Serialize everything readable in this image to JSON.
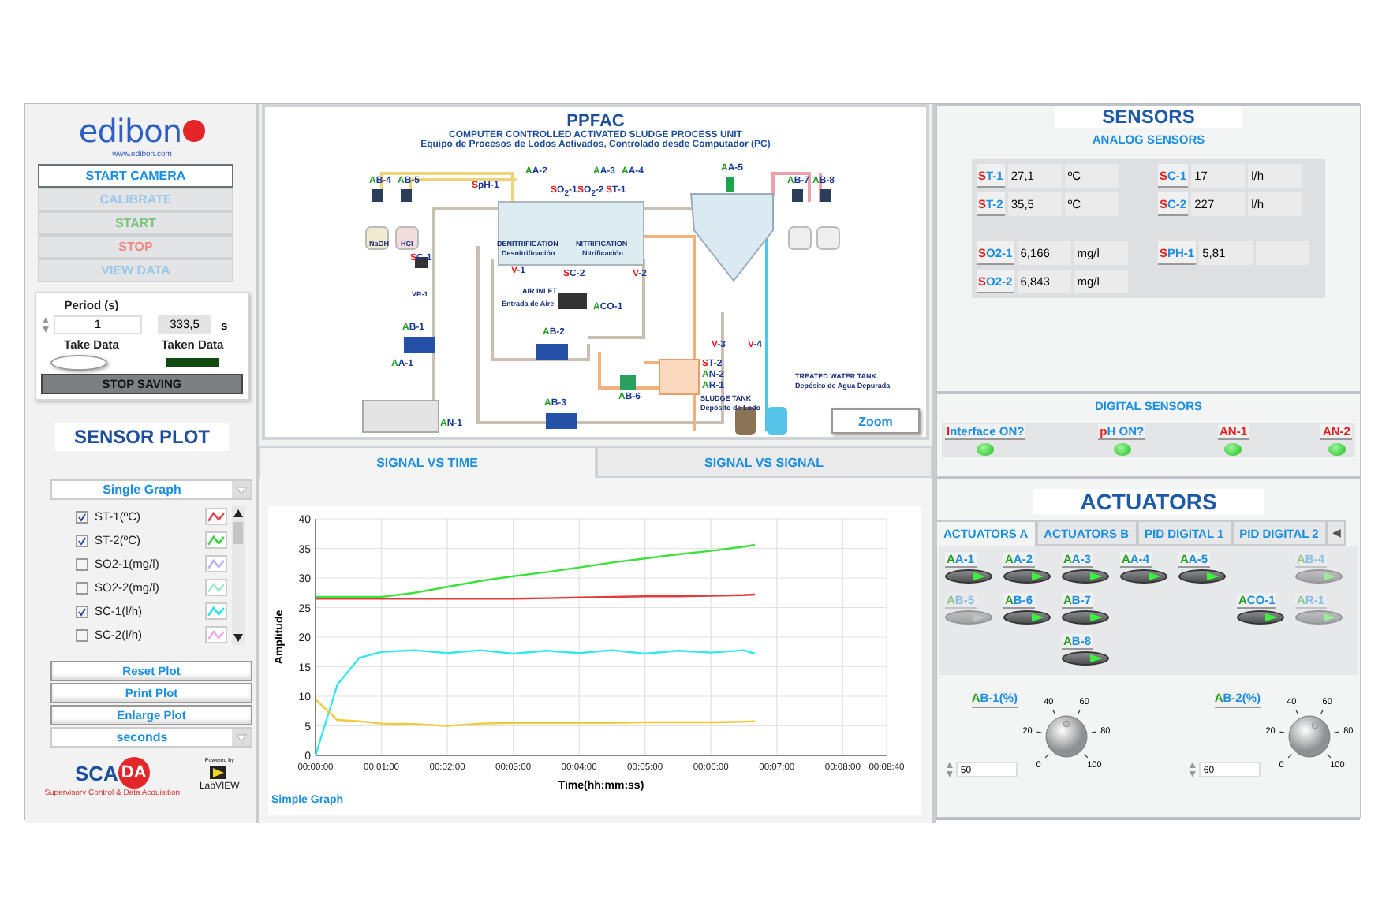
{
  "logo": {
    "brand": "edibon",
    "url": "www.edibon.com"
  },
  "control_buttons": [
    {
      "label": "START CAMERA",
      "color": "#1e8fe0",
      "disabled": false
    },
    {
      "label": "CALIBRATE",
      "color": "#9cc8ea",
      "disabled": true
    },
    {
      "label": "START",
      "color": "#7cc47c",
      "disabled": true
    },
    {
      "label": "STOP",
      "color": "#f08a8a",
      "disabled": true
    },
    {
      "label": "VIEW DATA",
      "color": "#9cc8ea",
      "disabled": true
    }
  ],
  "acquisition": {
    "period_label": "Period (s)",
    "period": "1",
    "elapsed": "333,5",
    "elapsed_unit": "s",
    "take_data": {
      "label": "Take Data",
      "on": false
    },
    "taken_data": {
      "label": "Taken Data",
      "on": false
    },
    "stop_button": "STOP SAVING"
  },
  "sensor_plot": {
    "title": "SENSOR PLOT",
    "mode": "Single Graph",
    "signals": [
      {
        "label": "ST-1(ºC)",
        "checked": true,
        "color": "#e05050"
      },
      {
        "label": "ST-2(ºC)",
        "checked": true,
        "color": "#40d040"
      },
      {
        "label": "SO2-1(mg/l)",
        "checked": false,
        "color": "#b8b8e8"
      },
      {
        "label": "SO2-2(mg/l)",
        "checked": false,
        "color": "#a8e8c8"
      },
      {
        "label": "SC-1(l/h)",
        "checked": true,
        "color": "#30e0e0"
      },
      {
        "label": "SC-2(l/h)",
        "checked": false,
        "color": "#e8b0e8"
      }
    ],
    "buttons": [
      "Reset Plot",
      "Print Plot",
      "Enlarge Plot"
    ],
    "time_unit": "seconds",
    "tabs": [
      {
        "label": "SIGNAL VS TIME",
        "selected": true
      },
      {
        "label": "SIGNAL VS SIGNAL",
        "selected": false
      }
    ],
    "chart_caption": "Simple Graph",
    "chart_data": {
      "type": "line",
      "xlabel": "Time(hh:mm:ss)",
      "ylabel": "Amplitude",
      "x": [
        0,
        20,
        40,
        60,
        90,
        120,
        150,
        180,
        210,
        240,
        270,
        300,
        330,
        360,
        390,
        400
      ],
      "series": [
        {
          "color": "#e03c3c",
          "values": [
            26.5,
            26.5,
            26.5,
            26.5,
            26.5,
            26.5,
            26.5,
            26.5,
            26.6,
            26.7,
            26.8,
            26.9,
            26.9,
            27.0,
            27.1,
            27.2
          ]
        },
        {
          "color": "#3ee03e",
          "values": [
            26.8,
            26.8,
            26.8,
            26.8,
            27.5,
            28.5,
            29.5,
            30.3,
            31.0,
            31.8,
            32.6,
            33.3,
            34.0,
            34.6,
            35.3,
            35.6
          ]
        },
        {
          "color": "#33e6f0",
          "values": [
            0,
            12,
            16.5,
            17.5,
            17.8,
            17.3,
            17.8,
            17.2,
            17.7,
            17.3,
            17.8,
            17.2,
            17.7,
            17.4,
            17.8,
            17.2
          ]
        },
        {
          "color": "#f0c93a",
          "values": [
            9.5,
            6.0,
            5.8,
            5.4,
            5.3,
            5.0,
            5.4,
            5.5,
            5.5,
            5.5,
            5.5,
            5.6,
            5.6,
            5.6,
            5.7,
            5.8
          ]
        }
      ],
      "xlim": [
        0,
        520
      ],
      "ylim": [
        0,
        40
      ],
      "grid": true,
      "xticks": [
        {
          "value": 0,
          "label": "00:00:00"
        },
        {
          "value": 60,
          "label": "00:01:00"
        },
        {
          "value": 120,
          "label": "00:02:00"
        },
        {
          "value": 180,
          "label": "00:03:00"
        },
        {
          "value": 240,
          "label": "00:04:00"
        },
        {
          "value": 300,
          "label": "00:05:00"
        },
        {
          "value": 360,
          "label": "00:06:00"
        },
        {
          "value": 420,
          "label": "00:07:00"
        },
        {
          "value": 480,
          "label": "00:08:00"
        },
        {
          "value": 520,
          "label": "00:08:40"
        }
      ],
      "yticks": [
        0,
        5,
        10,
        15,
        20,
        25,
        30,
        35,
        40
      ]
    }
  },
  "scada_logo": {
    "left": "SCA",
    "right": "DA",
    "tagline": "Supervisory Control & Data Acquisition"
  },
  "labview_logo": {
    "powered_by": "Powered by",
    "name": "LabVIEW"
  },
  "diagram": {
    "title": "PPFAC",
    "subtitle": "COMPUTER CONTROLLED ACTIVATED SLUDGE PROCESS UNIT",
    "subtitle_es": "Equipo de Procesos de Lodos Activados, Controlado desde Computador (PC)",
    "labels": [
      {
        "text": "AB-4",
        "kind": "actuator"
      },
      {
        "text": "AB-5",
        "kind": "actuator"
      },
      {
        "text": "SpH-1",
        "kind": "sensor"
      },
      {
        "text": "AA-2",
        "kind": "actuator"
      },
      {
        "text": "SO$_{2}$-1",
        "kind": "sensor"
      },
      {
        "text": "SO$_{2}$-2",
        "kind": "sensor"
      },
      {
        "text": "ST-1",
        "kind": "sensor"
      },
      {
        "text": "AA-3",
        "kind": "actuator"
      },
      {
        "text": "AA-4",
        "kind": "actuator"
      },
      {
        "text": "AA-5",
        "kind": "actuator"
      },
      {
        "text": "AB-7",
        "kind": "actuator"
      },
      {
        "text": "AB-8",
        "kind": "actuator"
      },
      {
        "text": "NaOH",
        "kind": "caption"
      },
      {
        "text": "HCl",
        "kind": "caption"
      },
      {
        "text": "SC-1",
        "kind": "sensor"
      },
      {
        "text": "DENITRIFICATION",
        "kind": "caption"
      },
      {
        "text": "Desnitrificación",
        "kind": "caption"
      },
      {
        "text": "NITRIFICATION",
        "kind": "caption"
      },
      {
        "text": "Nitrificación",
        "kind": "caption"
      },
      {
        "text": "V-1",
        "kind": "sensor"
      },
      {
        "text": "SC-2",
        "kind": "sensor"
      },
      {
        "text": "V-2",
        "kind": "sensor"
      },
      {
        "text": "AIR INLET",
        "kind": "caption"
      },
      {
        "text": "Entrada de Aire",
        "kind": "caption"
      },
      {
        "text": "ACO-1",
        "kind": "actuator"
      },
      {
        "text": "VR-1",
        "kind": "caption"
      },
      {
        "text": "AB-1",
        "kind": "actuator"
      },
      {
        "text": "AB-2",
        "kind": "actuator"
      },
      {
        "text": "AA-1",
        "kind": "actuator"
      },
      {
        "text": "V-3",
        "kind": "sensor"
      },
      {
        "text": "V-4",
        "kind": "sensor"
      },
      {
        "text": "ST-2",
        "kind": "sensor"
      },
      {
        "text": "AN-2",
        "kind": "actuator"
      },
      {
        "text": "AR-1",
        "kind": "actuator"
      },
      {
        "text": "AB-6",
        "kind": "actuator"
      },
      {
        "text": "AB-3",
        "kind": "actuator"
      },
      {
        "text": "AN-1",
        "kind": "actuator"
      },
      {
        "text": "SLUDGE TANK",
        "kind": "caption"
      },
      {
        "text": "Depósito de Lodo",
        "kind": "caption"
      },
      {
        "text": "TREATED WATER TANK",
        "kind": "caption"
      },
      {
        "text": "Depósito de Agua Depurada",
        "kind": "caption"
      }
    ],
    "zoom_button": "Zoom"
  },
  "sensors": {
    "title": "SENSORS",
    "analog_title": "ANALOG SENSORS",
    "analog": [
      {
        "label": "ST-1",
        "value": "27,1",
        "unit": "ºC"
      },
      {
        "label": "SC-1",
        "value": "17",
        "unit": "l/h"
      },
      {
        "label": "ST-2",
        "value": "35,5",
        "unit": "ºC"
      },
      {
        "label": "SC-2",
        "value": "227",
        "unit": "l/h"
      },
      {
        "label": "SO2-1",
        "value": "6,166",
        "unit": "mg/l"
      },
      {
        "label": "SPH-1",
        "value": "5,81"
      },
      {
        "label": "SO2-2",
        "value": "6,843",
        "unit": "mg/l"
      }
    ],
    "digital_title": "DIGITAL SENSORS",
    "digital": [
      {
        "label": "Interface ON?",
        "kind": "sensor",
        "on": true
      },
      {
        "label": "pH ON?",
        "kind": "sensor",
        "on": true
      },
      {
        "label": "AN-1",
        "kind": "alarm",
        "on": true
      },
      {
        "label": "AN-2",
        "kind": "alarm",
        "on": true
      }
    ]
  },
  "actuators": {
    "title": "ACTUATORS",
    "tabs": [
      {
        "label": "ACTUATORS A",
        "selected": true
      },
      {
        "label": "ACTUATORS B",
        "selected": false
      },
      {
        "label": "PID DIGITAL 1",
        "selected": false
      },
      {
        "label": "PID DIGITAL 2",
        "selected": false
      }
    ],
    "tab_scroll": "◀",
    "switches": [
      {
        "label": "AA-1",
        "on": true,
        "disabled": false
      },
      {
        "label": "AA-2",
        "on": true,
        "disabled": false
      },
      {
        "label": "AA-3",
        "on": true,
        "disabled": false
      },
      {
        "label": "AA-4",
        "on": true,
        "disabled": false
      },
      {
        "label": "AA-5",
        "on": true,
        "disabled": false
      },
      {
        "label": "AB-4",
        "on": true,
        "disabled": true
      },
      {
        "label": "AB-5",
        "on": false,
        "disabled": true
      },
      {
        "label": "AB-6",
        "on": true,
        "disabled": false
      },
      {
        "label": "AB-7",
        "on": true,
        "disabled": false
      },
      {
        "label": "ACO-1",
        "on": true,
        "disabled": false
      },
      {
        "label": "AR-1",
        "on": true,
        "disabled": true
      },
      {
        "label": "AB-8",
        "on": true,
        "disabled": false
      }
    ],
    "knobs": [
      {
        "label": "AB-1(%)",
        "value": "50",
        "level": 0.5,
        "scale": [
          "0",
          "20",
          "40",
          "60",
          "80",
          "100"
        ]
      },
      {
        "label": "AB-2(%)",
        "value": "60",
        "level": 0.6,
        "scale": [
          "0",
          "20",
          "40",
          "60",
          "80",
          "100"
        ]
      }
    ]
  }
}
